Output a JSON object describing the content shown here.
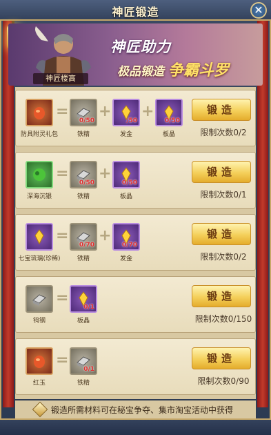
{
  "window": {
    "title": "神匠锻造",
    "close_glyph": "✕"
  },
  "banner": {
    "hero_caption": "神匠楼高",
    "headline": "神匠助力",
    "subline_prefix": "极品锻造",
    "subline_brand": "争霸斗罗"
  },
  "recipes": [
    {
      "result": {
        "label": "防具附灵礼包",
        "icon": "armor-gift-icon",
        "color": "red"
      },
      "materials": [
        {
          "label": "铁精",
          "icon": "iron-ingot-icon",
          "count": "0/50",
          "color": "gray"
        },
        {
          "label": "发金",
          "icon": "hair-gold-icon",
          "count": "/50",
          "color": "purple"
        },
        {
          "label": "板晶",
          "icon": "plate-crystal-icon",
          "count": "0/50",
          "color": "purple"
        }
      ],
      "button": "锻造",
      "limit": "限制次数0/2"
    },
    {
      "result": {
        "label": "深海沉银",
        "icon": "deep-sea-silver-icon",
        "color": "green"
      },
      "materials": [
        {
          "label": "铁精",
          "icon": "iron-ingot-icon",
          "count": "0/50",
          "color": "gray"
        },
        {
          "label": "板晶",
          "icon": "plate-crystal-icon",
          "count": "0/50",
          "color": "purple"
        }
      ],
      "button": "锻造",
      "limit": "限制次数0/1"
    },
    {
      "result": {
        "label": "七宝琉璃(珍稀)",
        "icon": "seven-treasure-icon",
        "color": "purple"
      },
      "materials": [
        {
          "label": "铁精",
          "icon": "iron-ingot-icon",
          "count": "0/70",
          "color": "gray"
        },
        {
          "label": "发金",
          "icon": "hair-gold-icon",
          "count": "0/70",
          "color": "purple"
        }
      ],
      "button": "锻造",
      "limit": "限制次数0/2"
    },
    {
      "result": {
        "label": "钨钢",
        "icon": "tungsten-steel-icon",
        "color": "gray"
      },
      "materials": [
        {
          "label": "板晶",
          "icon": "plate-crystal-icon",
          "count": "0/1",
          "color": "purple"
        }
      ],
      "button": "锻造",
      "limit": "限制次数0/150"
    },
    {
      "result": {
        "label": "红玉",
        "icon": "red-jade-icon",
        "color": "red"
      },
      "materials": [
        {
          "label": "铁精",
          "icon": "iron-ingot-icon",
          "count": "0/1",
          "color": "gray"
        }
      ],
      "button": "锻造",
      "limit": "限制次数0/90"
    }
  ],
  "footer": {
    "note": "锻造所需材料可在秘宝争夺、集市淘宝活动中获得"
  },
  "operators": {
    "equals": "=",
    "plus": "+"
  }
}
